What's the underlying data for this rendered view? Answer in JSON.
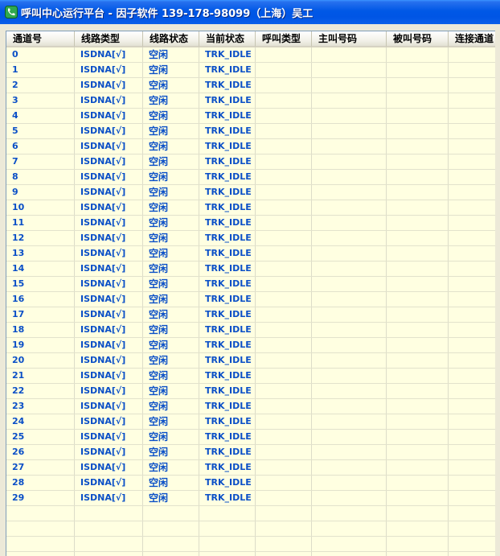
{
  "window": {
    "title": "呼叫中心运行平台 - 因子软件 139-178-98099（上海）吴工"
  },
  "table": {
    "columns": [
      "通道号",
      "线路类型",
      "线路状态",
      "当前状态",
      "呼叫类型",
      "主叫号码",
      "被叫号码",
      "连接通道"
    ],
    "rows": [
      [
        "0",
        "ISDNA[√]",
        "空闲",
        "TRK_IDLE",
        "",
        "",
        "",
        ""
      ],
      [
        "1",
        "ISDNA[√]",
        "空闲",
        "TRK_IDLE",
        "",
        "",
        "",
        ""
      ],
      [
        "2",
        "ISDNA[√]",
        "空闲",
        "TRK_IDLE",
        "",
        "",
        "",
        ""
      ],
      [
        "3",
        "ISDNA[√]",
        "空闲",
        "TRK_IDLE",
        "",
        "",
        "",
        ""
      ],
      [
        "4",
        "ISDNA[√]",
        "空闲",
        "TRK_IDLE",
        "",
        "",
        "",
        ""
      ],
      [
        "5",
        "ISDNA[√]",
        "空闲",
        "TRK_IDLE",
        "",
        "",
        "",
        ""
      ],
      [
        "6",
        "ISDNA[√]",
        "空闲",
        "TRK_IDLE",
        "",
        "",
        "",
        ""
      ],
      [
        "7",
        "ISDNA[√]",
        "空闲",
        "TRK_IDLE",
        "",
        "",
        "",
        ""
      ],
      [
        "8",
        "ISDNA[√]",
        "空闲",
        "TRK_IDLE",
        "",
        "",
        "",
        ""
      ],
      [
        "9",
        "ISDNA[√]",
        "空闲",
        "TRK_IDLE",
        "",
        "",
        "",
        ""
      ],
      [
        "10",
        "ISDNA[√]",
        "空闲",
        "TRK_IDLE",
        "",
        "",
        "",
        ""
      ],
      [
        "11",
        "ISDNA[√]",
        "空闲",
        "TRK_IDLE",
        "",
        "",
        "",
        ""
      ],
      [
        "12",
        "ISDNA[√]",
        "空闲",
        "TRK_IDLE",
        "",
        "",
        "",
        ""
      ],
      [
        "13",
        "ISDNA[√]",
        "空闲",
        "TRK_IDLE",
        "",
        "",
        "",
        ""
      ],
      [
        "14",
        "ISDNA[√]",
        "空闲",
        "TRK_IDLE",
        "",
        "",
        "",
        ""
      ],
      [
        "15",
        "ISDNA[√]",
        "空闲",
        "TRK_IDLE",
        "",
        "",
        "",
        ""
      ],
      [
        "16",
        "ISDNA[√]",
        "空闲",
        "TRK_IDLE",
        "",
        "",
        "",
        ""
      ],
      [
        "17",
        "ISDNA[√]",
        "空闲",
        "TRK_IDLE",
        "",
        "",
        "",
        ""
      ],
      [
        "18",
        "ISDNA[√]",
        "空闲",
        "TRK_IDLE",
        "",
        "",
        "",
        ""
      ],
      [
        "19",
        "ISDNA[√]",
        "空闲",
        "TRK_IDLE",
        "",
        "",
        "",
        ""
      ],
      [
        "20",
        "ISDNA[√]",
        "空闲",
        "TRK_IDLE",
        "",
        "",
        "",
        ""
      ],
      [
        "21",
        "ISDNA[√]",
        "空闲",
        "TRK_IDLE",
        "",
        "",
        "",
        ""
      ],
      [
        "22",
        "ISDNA[√]",
        "空闲",
        "TRK_IDLE",
        "",
        "",
        "",
        ""
      ],
      [
        "23",
        "ISDNA[√]",
        "空闲",
        "TRK_IDLE",
        "",
        "",
        "",
        ""
      ],
      [
        "24",
        "ISDNA[√]",
        "空闲",
        "TRK_IDLE",
        "",
        "",
        "",
        ""
      ],
      [
        "25",
        "ISDNA[√]",
        "空闲",
        "TRK_IDLE",
        "",
        "",
        "",
        ""
      ],
      [
        "26",
        "ISDNA[√]",
        "空闲",
        "TRK_IDLE",
        "",
        "",
        "",
        ""
      ],
      [
        "27",
        "ISDNA[√]",
        "空闲",
        "TRK_IDLE",
        "",
        "",
        "",
        ""
      ],
      [
        "28",
        "ISDNA[√]",
        "空闲",
        "TRK_IDLE",
        "",
        "",
        "",
        ""
      ],
      [
        "29",
        "ISDNA[√]",
        "空闲",
        "TRK_IDLE",
        "",
        "",
        "",
        ""
      ]
    ],
    "empty_rows": 3
  },
  "colors": {
    "title_bar": "#0058E6",
    "grid_background": "#FFFFE1",
    "cell_text": "#0A4FC7"
  }
}
